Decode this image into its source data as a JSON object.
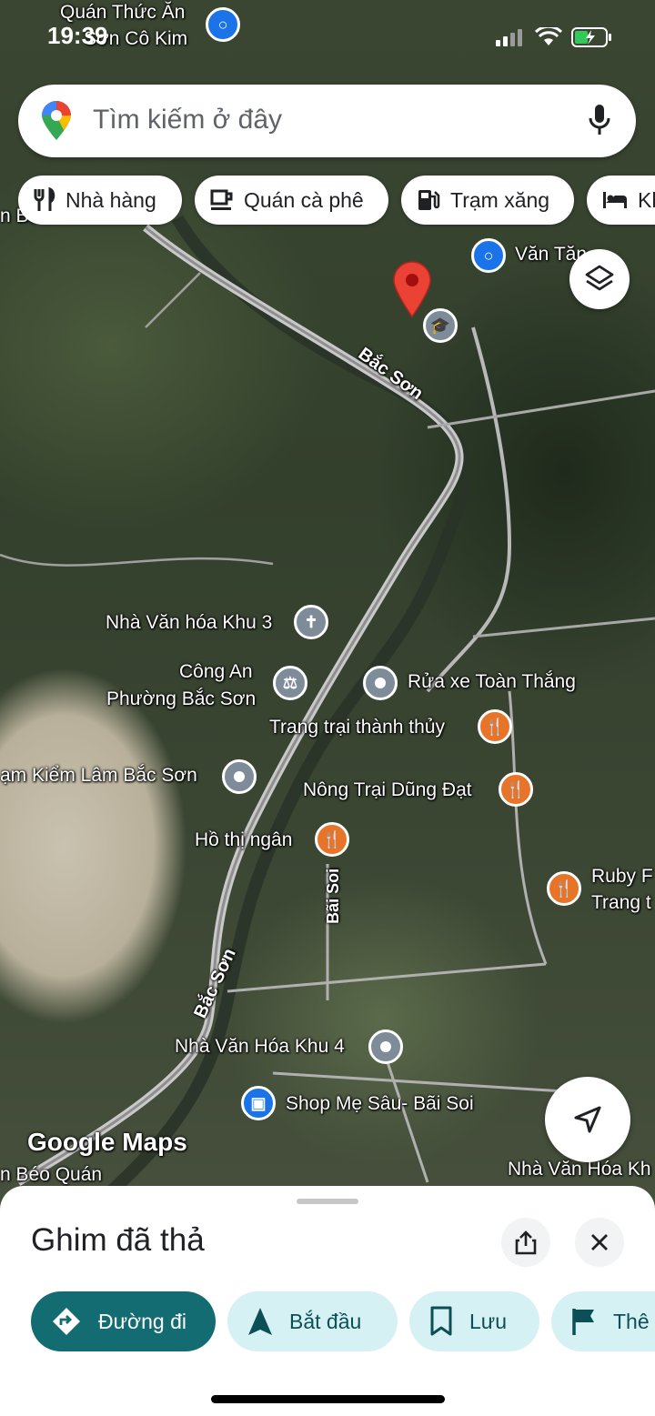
{
  "status_bar": {
    "time": "19:39"
  },
  "search": {
    "placeholder": "Tìm kiếm ở đây"
  },
  "chips": [
    {
      "label": "Nhà hàng",
      "icon": "fork-knife-icon"
    },
    {
      "label": "Quán cà phê",
      "icon": "coffee-cup-icon"
    },
    {
      "label": "Trạm xăng",
      "icon": "gas-pump-icon"
    },
    {
      "label": "Kh",
      "icon": "bed-icon"
    }
  ],
  "map": {
    "brand": "Google Maps",
    "roads": {
      "bac_son_1": "Bắc Sơn",
      "bac_son_2": "Bắc Sơn",
      "bai_soi": "Bãi Soi"
    },
    "places": {
      "quan_thuc_an_1": "Quán Thức Ăn",
      "quan_thuc_an_2": "Sơn Cô Kim",
      "van_tan": "Văn Tăn",
      "edge_left_top": "n Bắc",
      "nha_van_hoa_khu3": "Nhà Văn hóa Khu 3",
      "cong_an_1": "Công An",
      "cong_an_2": "Phường Bắc Sơn",
      "rua_xe": "Rửa xe Toàn Thắng",
      "trang_trai": "Trang trại thành thủy",
      "kiem_lam": "ạm Kiểm Lâm Bắc Sơn",
      "nong_trai": "Nông Trại Dũng Đạt",
      "ho_thi_ngan": "Hồ thị ngân",
      "ruby_1": "Ruby F",
      "ruby_2": "Trang t",
      "nha_van_hoa_khu4": "Nhà Văn Hóa Khu 4",
      "shop_me_sau": "Shop Mẹ Sâu- Bãi Soi",
      "beo_quan": "n Béo Quán",
      "nha_van_hoa_edge": "Nhà Văn Hóa Kh"
    }
  },
  "sheet": {
    "title": "Ghim đã thả",
    "actions": [
      {
        "label": "Đường đi",
        "icon": "directions-icon"
      },
      {
        "label": "Bắt đầu",
        "icon": "navigation-arrow-icon"
      },
      {
        "label": "Lưu",
        "icon": "bookmark-icon"
      },
      {
        "label": "Thê",
        "icon": "flag-icon"
      }
    ]
  },
  "colors": {
    "accent": "#146c73",
    "secondary": "#d6f1f4",
    "pin_red": "#ea4335",
    "poi_orange": "#e8742a",
    "poi_gray": "#7e8c99",
    "poi_blue": "#1a73e8"
  }
}
